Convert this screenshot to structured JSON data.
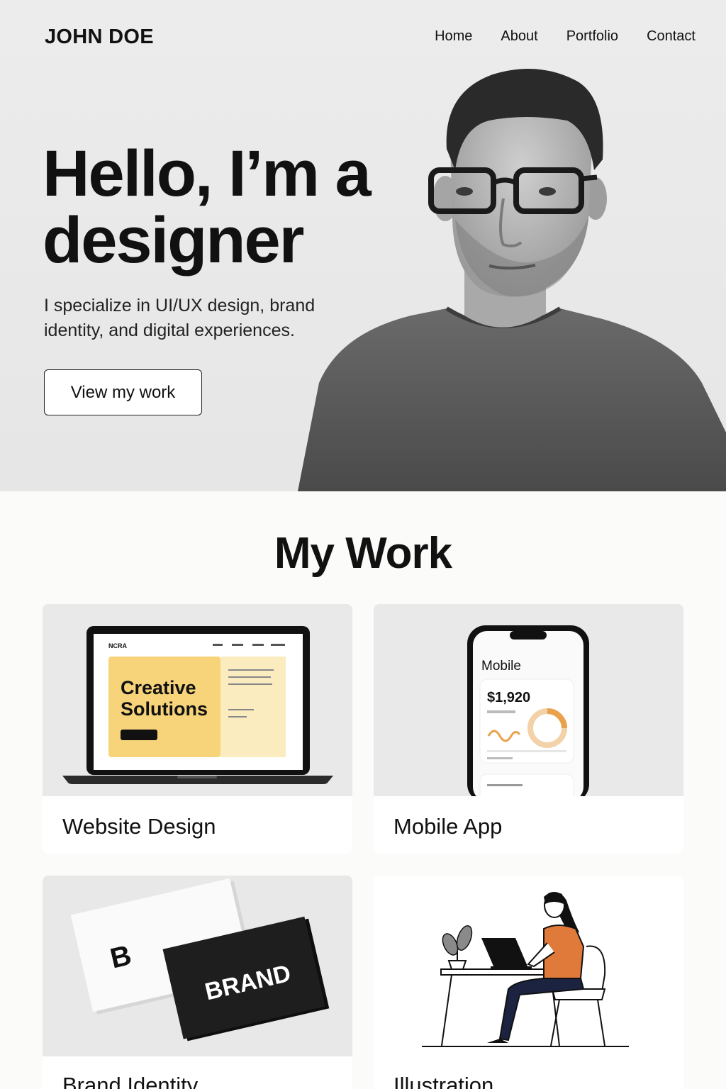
{
  "header": {
    "logo": "JOHN DOE",
    "nav": [
      "Home",
      "About",
      "Portfolio",
      "Contact"
    ]
  },
  "hero": {
    "title": "Hello, I’m a designer",
    "subtitle": "I specialize in UI/UX design, brand identity, and digital experiences.",
    "cta": "View my work"
  },
  "work": {
    "title": "My Work",
    "cards": [
      {
        "label": "Website Design",
        "mock_heading": "Creative Solutions",
        "mock_logo": "NCRA"
      },
      {
        "label": "Mobile App",
        "mock_heading": "Mobile",
        "mock_amount": "$1,920"
      },
      {
        "label": "Brand Identity",
        "mock_letter": "B",
        "mock_brand": "BRAND"
      },
      {
        "label": "Illustration"
      }
    ]
  },
  "colors": {
    "accent_yellow": "#f7d47a",
    "accent_orange": "#e07a3a",
    "dark": "#111111"
  }
}
